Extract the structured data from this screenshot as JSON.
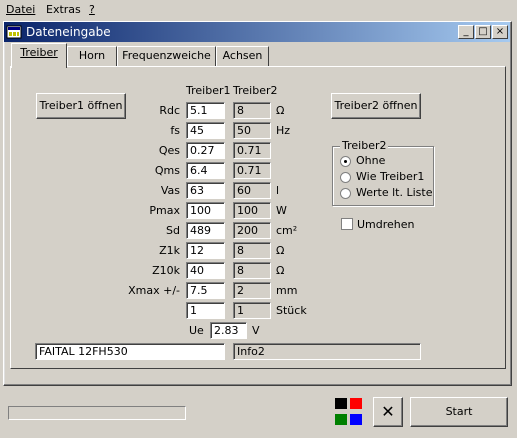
{
  "menu": [
    "Datei",
    "Extras",
    "?"
  ],
  "window": {
    "title": "Dateneingabe"
  },
  "tabs": [
    "Treiber",
    "Horn",
    "Frequenzweiche",
    "Achsen"
  ],
  "buttons": {
    "open1": "Treiber1 öffnen",
    "open2": "Treiber2 öffnen",
    "start": "Start",
    "close": "✕"
  },
  "headers": {
    "t1": "Treiber1",
    "t2": "Treiber2"
  },
  "params": [
    {
      "label": "Rdc",
      "t1": "5.1",
      "t2": "8",
      "unit": "Ω"
    },
    {
      "label": "fs",
      "t1": "45",
      "t2": "50",
      "unit": "Hz"
    },
    {
      "label": "Qes",
      "t1": "0.27",
      "t2": "0.71",
      "unit": ""
    },
    {
      "label": "Qms",
      "t1": "6.4",
      "t2": "0.71",
      "unit": ""
    },
    {
      "label": "Vas",
      "t1": "63",
      "t2": "60",
      "unit": "l"
    },
    {
      "label": "Pmax",
      "t1": "100",
      "t2": "100",
      "unit": "W"
    },
    {
      "label": "Sd",
      "t1": "489",
      "t2": "200",
      "unit": "cm²"
    },
    {
      "label": "Z1k",
      "t1": "12",
      "t2": "8",
      "unit": "Ω"
    },
    {
      "label": "Z10k",
      "t1": "40",
      "t2": "8",
      "unit": "Ω"
    },
    {
      "label": "Xmax +/-",
      "t1": "7.5",
      "t2": "2",
      "unit": "mm"
    },
    {
      "label": "",
      "t1": "1",
      "t2": "1",
      "unit": "Stück"
    }
  ],
  "ue": {
    "label": "Ue",
    "value": "2.83",
    "unit": "V"
  },
  "names": {
    "t1": "FAITAL 12FH530",
    "t2": "Info2"
  },
  "group": {
    "title": "Treiber2",
    "options": [
      "Ohne",
      "Wie Treiber1",
      "Werte lt. Liste"
    ],
    "selected": 0
  },
  "umdrehen": {
    "label": "Umdrehen",
    "checked": false
  },
  "swatches": [
    "#000000",
    "#ff0000",
    "#008000",
    "#0000ff"
  ]
}
